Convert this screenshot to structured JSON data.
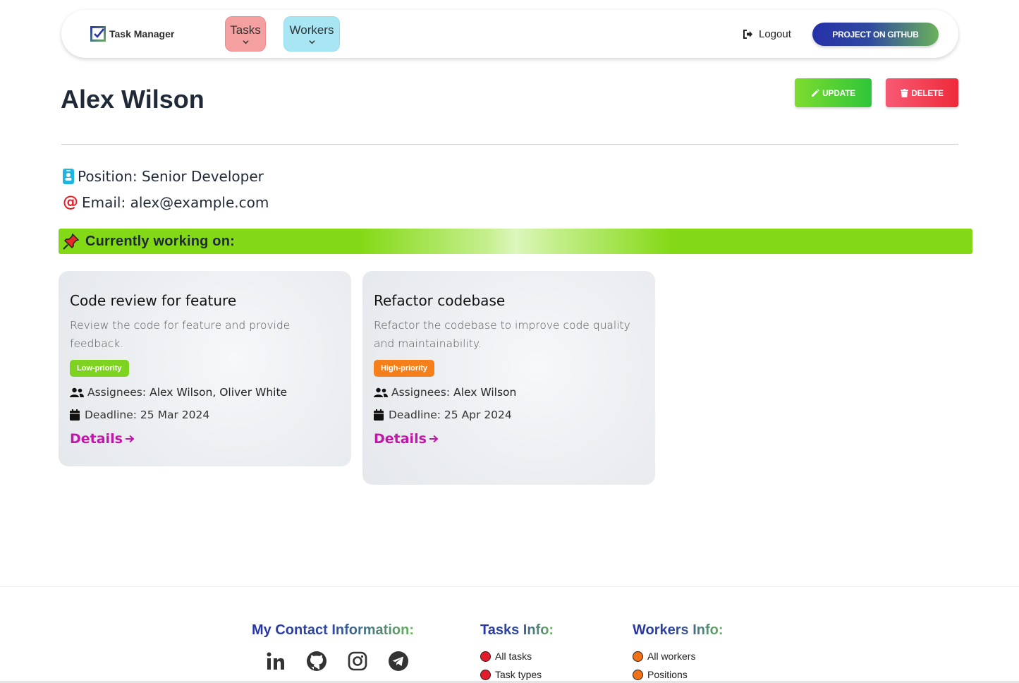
{
  "navbar": {
    "brand": "Task Manager",
    "tasks_label": "Tasks",
    "workers_label": "Workers",
    "logout_label": "Logout",
    "github_label": "PROJECT ON GITHUB"
  },
  "worker": {
    "name": "Alex Wilson",
    "position": "Position: Senior Developer",
    "email": "Email: alex@example.com"
  },
  "actions": {
    "update_label": "UPDATE",
    "delete_label": "DELETE"
  },
  "working_on": {
    "label": "Currently working on:"
  },
  "tasks": [
    {
      "title": "Code review for feature",
      "description": "Review the code for feature and provide feedback.",
      "priority": "Low-priority",
      "assignees_label": "Assignees:",
      "assignees": "Alex Wilson, Oliver White",
      "deadline": "Deadline: 25 Mar 2024",
      "details_label": "Details"
    },
    {
      "title": "Refactor codebase",
      "description": "Refactor the codebase to improve code quality and maintainability.",
      "priority": "High-priority",
      "assignees_label": "Assignees:",
      "assignees": "Alex Wilson",
      "deadline": "Deadline: 25 Apr 2024",
      "details_label": "Details"
    }
  ],
  "footer": {
    "contact_title": "My Contact Information:",
    "social_icons": [
      "linkedin-icon",
      "github-icon",
      "instagram-icon",
      "telegram-icon"
    ],
    "tasks_title": "Tasks Info:",
    "tasks_links": [
      "All tasks",
      "Task types"
    ],
    "workers_title": "Workers Info:",
    "workers_links": [
      "All workers",
      "Positions"
    ]
  },
  "colors": {
    "tasks_nav": "#f5a0a0",
    "workers_nav": "#a8e6f4",
    "update": "#2fc53a",
    "delete": "#ee2a3b",
    "working_bar": "#84d916",
    "low_priority": "#7ed321",
    "high_priority": "#f5801b",
    "details_link": "#c116a9"
  }
}
